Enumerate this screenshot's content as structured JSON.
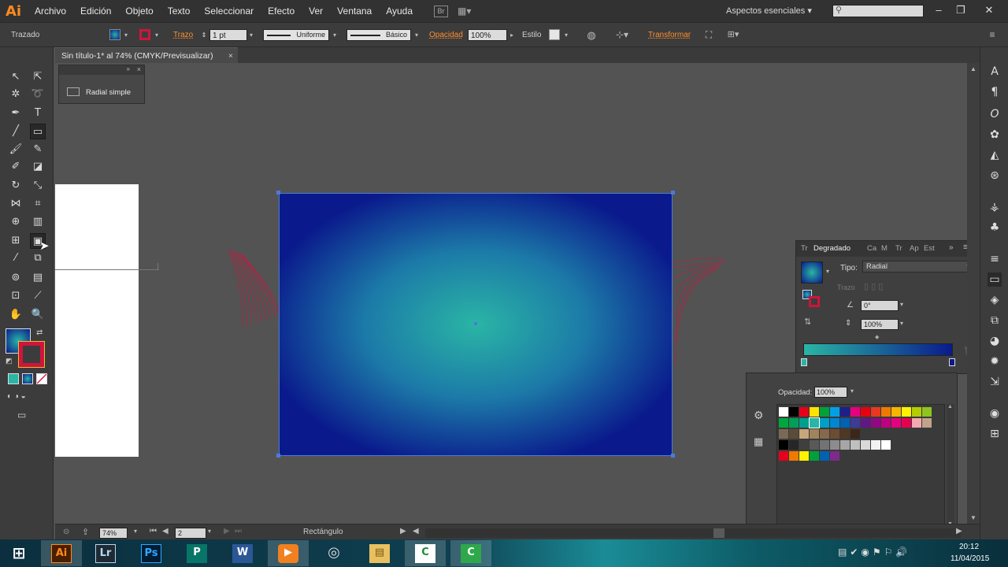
{
  "app": {
    "logo": "Ai"
  },
  "menu": [
    "Archivo",
    "Edición",
    "Objeto",
    "Texto",
    "Seleccionar",
    "Efecto",
    "Ver",
    "Ventana",
    "Ayuda"
  ],
  "bridge_label": "Br",
  "workspace": "Aspectos esenciales",
  "control": {
    "selection_label": "Trazado",
    "stroke_label": "Trazo",
    "stroke_weight": "1 pt",
    "profile_label": "Uniforme",
    "brush_label": "Básico",
    "opacity_label": "Opacidad",
    "opacity_value": "100%",
    "style_label": "Estilo",
    "transform_label": "Transformar"
  },
  "document": {
    "tab_title": "Sin título-1* al 74% (CMYK/Previsualizar)",
    "close": "×"
  },
  "brush_panel": {
    "item_label": "Radial simple"
  },
  "gradient_panel": {
    "tabs": [
      "Tr",
      "Degradado",
      "Ca",
      "M",
      "Tr",
      "Ap",
      "Est"
    ],
    "active_tab": "Degradado",
    "type_label": "Tipo:",
    "type_value": "Radial",
    "stroke_label": "Trazo",
    "angle_value": "0°",
    "aspect_value": "100%",
    "colors": {
      "start": "#2ab5a5",
      "end": "#0a1a8c"
    }
  },
  "swatch_panel": {
    "opacity_label": "Opacidad:",
    "opacity_value": "100%"
  },
  "status": {
    "zoom": "74%",
    "artboard": "2",
    "tool_name": "Rectángulo"
  },
  "taskbar": {
    "time": "20:12",
    "date": "11/04/2015",
    "apps": [
      "Ai",
      "Lr",
      "Ps",
      "P",
      "W",
      "▶",
      "◎",
      "▤",
      "C",
      "C"
    ]
  },
  "colors": {
    "accent": "#ff8f2f",
    "artboard_gradient_inner": "#2ab5a5",
    "artboard_gradient_outer": "#0a1a8c",
    "wave_red": "#d0143c"
  }
}
